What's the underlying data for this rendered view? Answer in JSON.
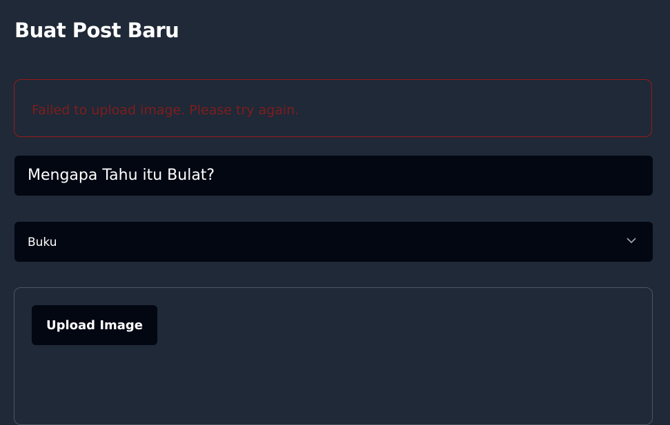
{
  "page": {
    "title": "Buat Post Baru"
  },
  "error": {
    "message": "Failed to upload image. Please try again."
  },
  "form": {
    "title_value": "Mengapa Tahu itu Bulat?",
    "category_selected": "Buku",
    "upload_label": "Upload Image"
  },
  "colors": {
    "background": "#1f2937",
    "input": "#030712",
    "error_border": "#991b1b",
    "error_text": "#7f1d1d"
  }
}
